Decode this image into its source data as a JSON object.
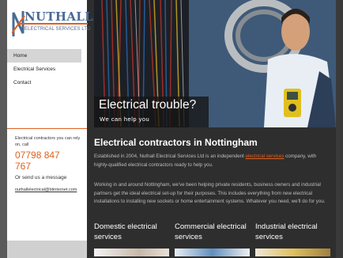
{
  "logo": {
    "brand": "NUTHALL",
    "subtitle": "ELECTRICAL SERVICES LTD"
  },
  "nav": {
    "items": [
      {
        "label": "Home",
        "active": true
      },
      {
        "label": "Electrical Services",
        "active": false
      },
      {
        "label": "Contact",
        "active": false
      }
    ]
  },
  "contact": {
    "intro": "Electrical contractors you can rely on, call",
    "phone": "07798 847 767",
    "email_label": "Or send us a message",
    "email": "nuthallelectrical@btinternet.com"
  },
  "hero": {
    "title": "Electrical trouble?",
    "subtitle": "We can help you"
  },
  "main": {
    "heading": "Electrical contractors in Nottingham",
    "para1_before": "Established in 2004, Nuthall Electrical Services Ltd is an independent ",
    "para1_link": "electrical services",
    "para1_after": " company, with highly-qualified electrical contractors ready to help you.",
    "para2": "Working in and around Nottingham, we've been helping private residents, business owners and industrial partners get the ideal electrical set-up for their purposes. This includes everything from new electrical installations to installing new sockets or home entertainment systems. Whatever you need, we'll do for you."
  },
  "services": [
    {
      "title": "Domestic electrical services"
    },
    {
      "title": "Commercial electrical services"
    },
    {
      "title": "Industrial electrical services"
    }
  ],
  "colors": {
    "accent": "#e06020",
    "brand": "#4a6b96",
    "background": "#2e2e2e"
  }
}
